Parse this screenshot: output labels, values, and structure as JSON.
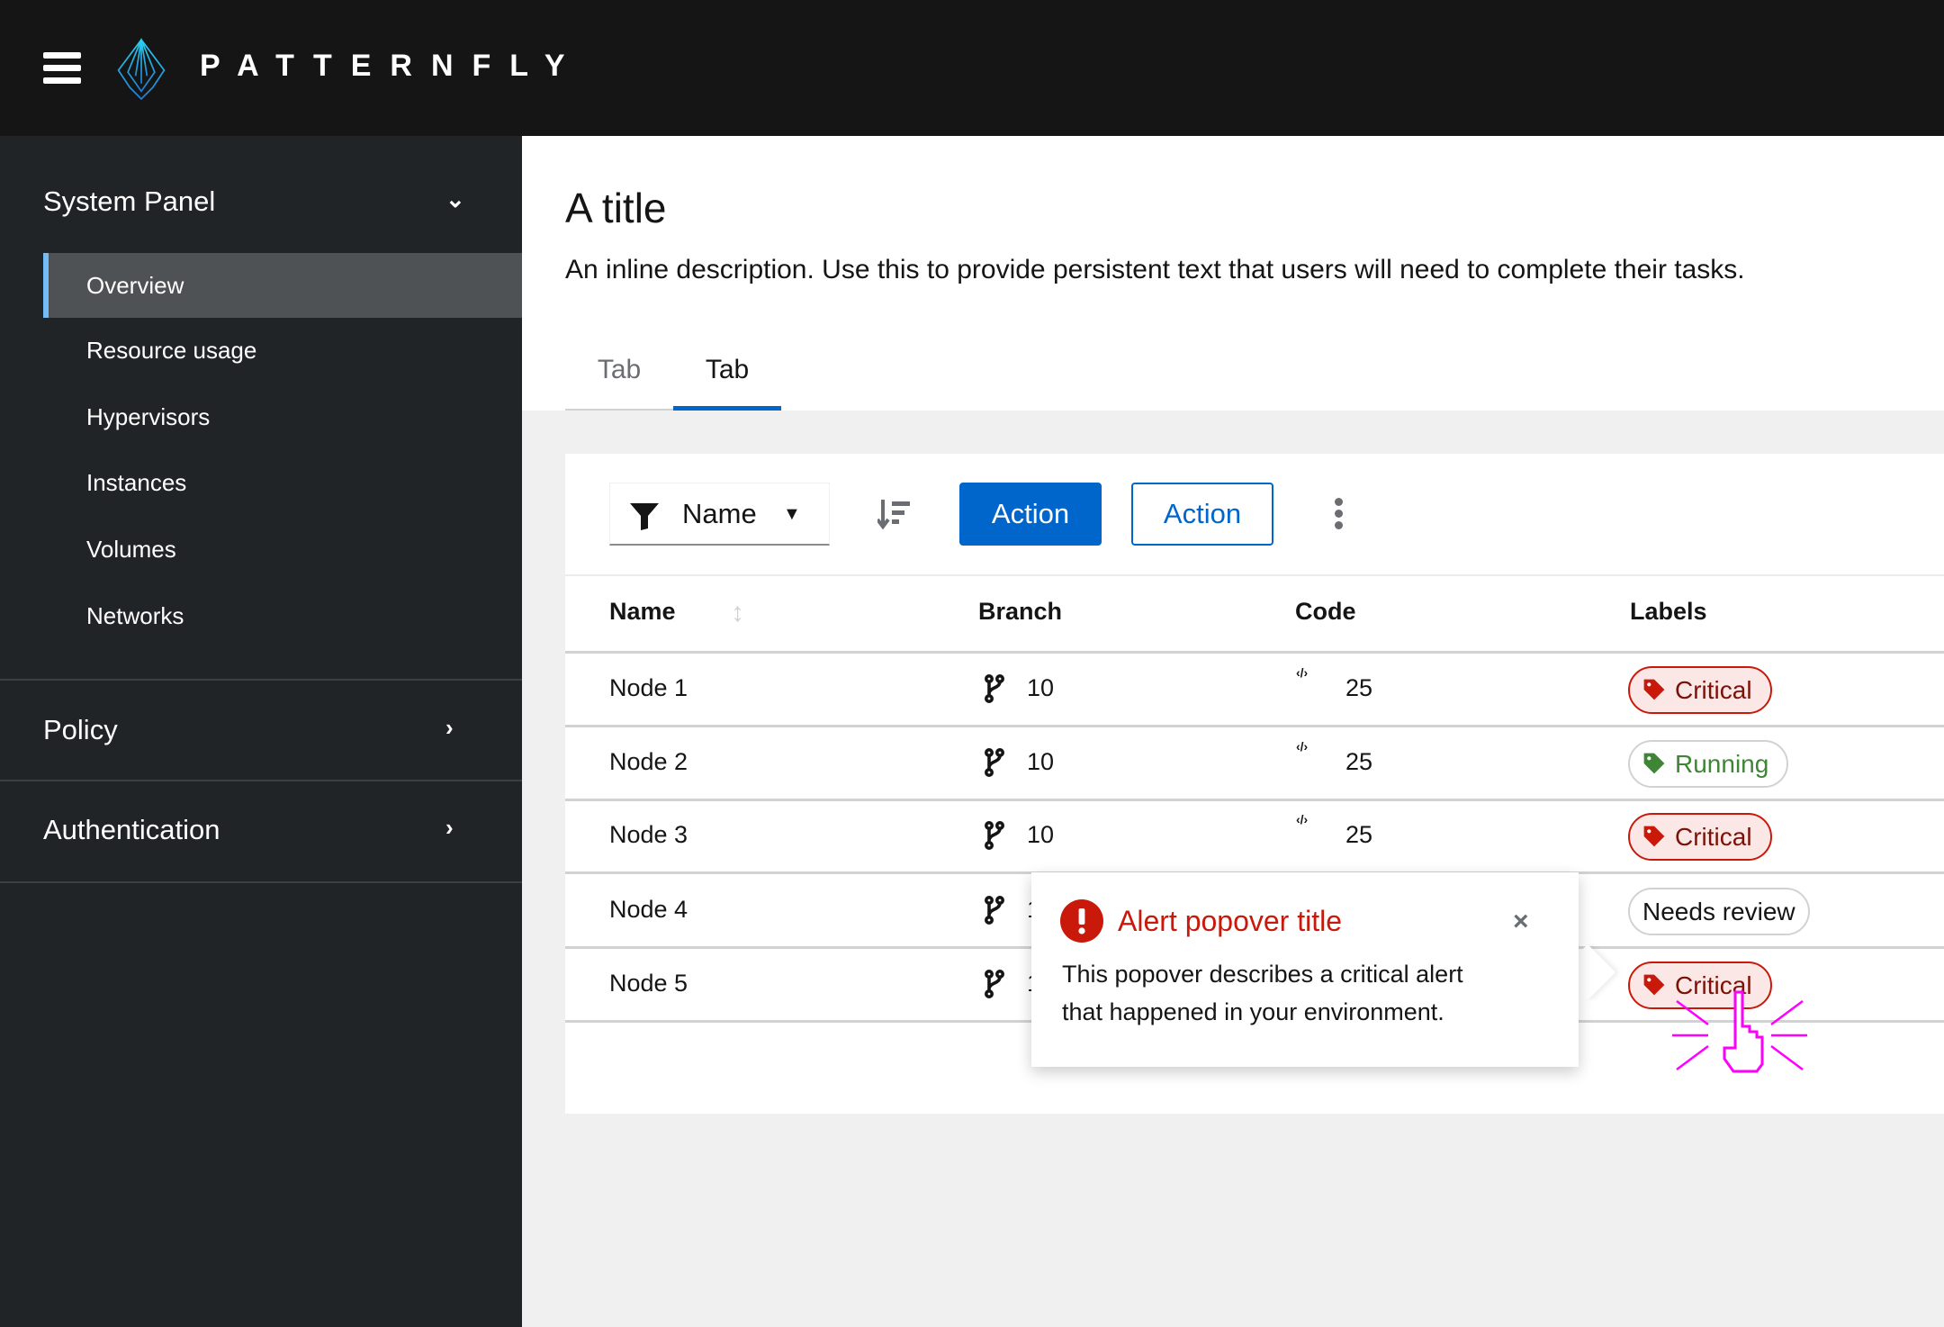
{
  "header": {
    "brand": "PATTERNFLY"
  },
  "sidebar": {
    "groups": [
      {
        "label": "System Panel",
        "expanded": true
      },
      {
        "label": "Policy",
        "expanded": false
      },
      {
        "label": "Authentication",
        "expanded": false
      }
    ],
    "items": [
      {
        "label": "Overview",
        "active": true
      },
      {
        "label": "Resource usage"
      },
      {
        "label": "Hypervisors"
      },
      {
        "label": "Instances"
      },
      {
        "label": "Volumes"
      },
      {
        "label": "Networks"
      }
    ]
  },
  "page": {
    "title": "A title",
    "description": "An inline description. Use this to provide persistent text that users will need to complete their tasks.",
    "tabs": [
      {
        "label": "Tab"
      },
      {
        "label": "Tab",
        "active": true
      }
    ]
  },
  "toolbar": {
    "filter_label": "Name",
    "primary_action": "Action",
    "secondary_action": "Action"
  },
  "table": {
    "columns": [
      "Name",
      "Branch",
      "Code",
      "Labels"
    ],
    "rows": [
      {
        "name": "Node 1",
        "branch": "10",
        "code": "25",
        "label": "Critical",
        "label_status": "critical"
      },
      {
        "name": "Node 2",
        "branch": "10",
        "code": "25",
        "label": "Running",
        "label_status": "running"
      },
      {
        "name": "Node 3",
        "branch": "10",
        "code": "25",
        "label": "Critical",
        "label_status": "critical"
      },
      {
        "name": "Node 4",
        "branch": "1",
        "label": "Needs review",
        "label_status": "neutral"
      },
      {
        "name": "Node 5",
        "branch": "1",
        "label": "Critical",
        "label_status": "critical"
      }
    ]
  },
  "popover": {
    "title": "Alert popover title",
    "body": "This popover describes a critical alert that happened in your environment."
  },
  "colors": {
    "primary": "#0066cc",
    "danger": "#c9190b",
    "success": "#3e8635",
    "header_bg": "#151515",
    "sidebar_bg": "#212427",
    "cursor": "#ff00ff"
  }
}
